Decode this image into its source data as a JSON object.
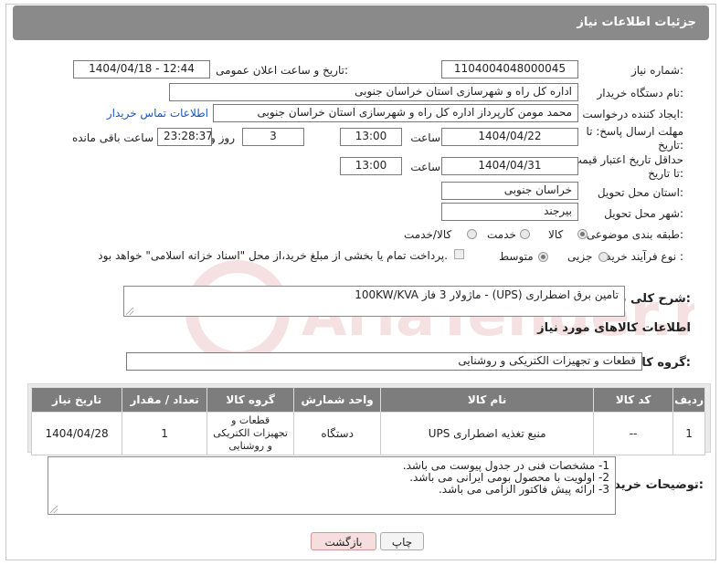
{
  "header": {
    "title": "جزئیات اطلاعات نیاز"
  },
  "form": {
    "need_number_label": "شماره نیاز:",
    "need_number": "1104004048000045",
    "announce_label": "تاریخ و ساعت اعلان عمومی:",
    "announce_value": "1404/04/18 - 12:44",
    "buyer_org_label": "نام دستگاه خریدار:",
    "buyer_org": "اداره کل راه و شهرسازی استان خراسان جنوبی",
    "creator_label": "ایجاد کننده درخواست:",
    "creator": "محمد مومن کارپرداز اداره کل راه و شهرسازی استان خراسان جنوبی",
    "contact_link": "اطلاعات تماس خریدار",
    "reply_deadline_label": "مهلت ارسال پاسخ: تا تاریخ:",
    "reply_date": "1404/04/22",
    "time_label": "ساعت",
    "reply_time": "13:00",
    "days_value": "3",
    "days_label": "روز و",
    "remaining_time": "23:28:37",
    "remaining_label": "ساعت باقی مانده",
    "price_validity_label": "حداقل تاریخ اعتبار قیمت: تا تاریخ:",
    "price_date": "1404/04/31",
    "price_time": "13:00",
    "province_label": "استان محل تحویل:",
    "province": "خراسان جنوبی",
    "city_label": "شهر محل تحویل:",
    "city": "بیرجند",
    "category_label": "طبقه بندی موضوعی:",
    "category_options": [
      "کالا",
      "خدمت",
      "کالا/خدمت"
    ],
    "category_selected": "کالا",
    "process_label": "نوع فرآیند خرید :",
    "process_options": [
      "جزیی",
      "متوسط"
    ],
    "process_selected": "متوسط",
    "payment_note": "پرداخت تمام یا بخشی از مبلغ خرید،از محل \"اسناد خزانه اسلامی\" خواهد بود."
  },
  "description": {
    "label": "شرح کلی نیاز:",
    "value": "تامین برق اضطراری (UPS) - ماژولار 3 فاز  100KW/KVA"
  },
  "goods_info": {
    "title": "اطلاعات کالاهای مورد نیاز",
    "group_label": "گروه کالا:",
    "group_value": "قطعات و تجهیزات الکتریکی و روشنایی"
  },
  "table": {
    "headers": [
      "ردیف",
      "کد کالا",
      "نام کالا",
      "واحد شمارش",
      "گروه کالا",
      "تعداد / مقدار",
      "تاریخ نیاز"
    ],
    "rows": [
      {
        "row": "1",
        "code": "--",
        "name": "منبع تغذیه اضطراری UPS",
        "unit": "دستگاه",
        "group": "قطعات و تجهیزات الکتریکی و روشنایی",
        "qty": "1",
        "date": "1404/04/28"
      }
    ]
  },
  "buyer_notes": {
    "label": "توضیحات خریدار:",
    "lines": [
      "1- مشخصات فنی در جدول پیوست می باشد.",
      "2- اولویت با محصول بومی ایرانی می باشد.",
      "3- ارائه پیش فاکتور الزامی می باشد."
    ]
  },
  "buttons": {
    "print": "چاپ",
    "back": "بازگشت"
  },
  "watermark_text": "AriaTender.net",
  "colors": {
    "header_bg": "#8a8a8a",
    "link": "#1a56c4",
    "back_btn_bg": "#f7dede"
  }
}
